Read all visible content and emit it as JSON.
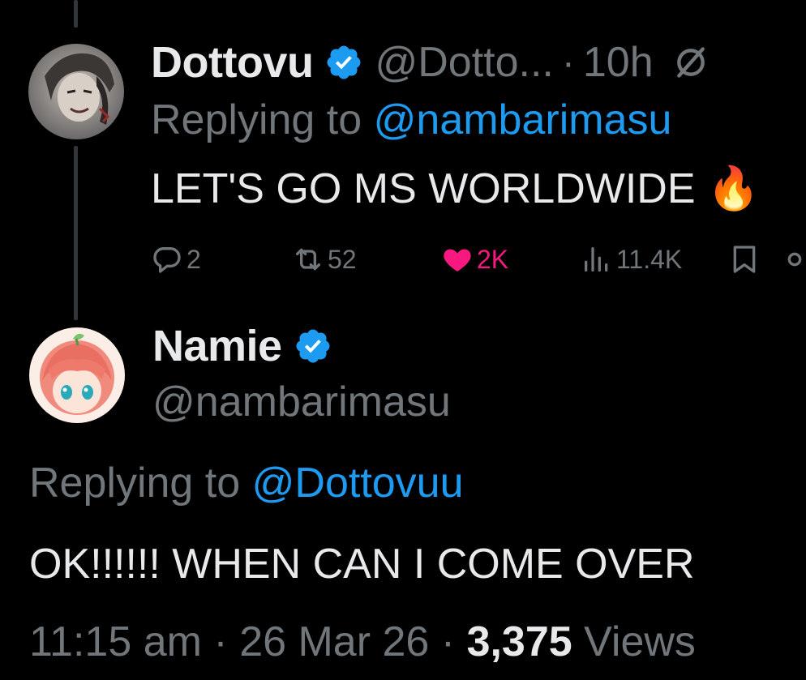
{
  "parent_tweet": {
    "display_name": "Dottovu",
    "handle": "@Dotto...",
    "separator": "·",
    "time_ago": "10h",
    "replying_prefix": "Replying to",
    "replying_to": "@nambarimasu",
    "text": "LET'S GO MS WORLDWIDE",
    "emoji": "🔥",
    "actions": {
      "replies": "2",
      "retweets": "52",
      "likes": "2K",
      "views": "11.4K"
    }
  },
  "main_tweet": {
    "display_name": "Namie",
    "handle": "@nambarimasu",
    "replying_prefix": "Replying to",
    "replying_to": "@Dottovuu",
    "text": "OK!!!!!! WHEN CAN I COME OVER",
    "time": "11:15 am",
    "separator": "·",
    "date": "26 Mar 26",
    "views_count": "3,375",
    "views_label": "Views"
  },
  "colors": {
    "background": "#000000",
    "text": "#e7e9ea",
    "muted": "#71767b",
    "link": "#1d9bf0",
    "verified": "#1d9bf0",
    "like": "#f91880",
    "thread_line": "#333639"
  },
  "icons": [
    "verified-badge-icon",
    "grok-icon",
    "reply-icon",
    "retweet-icon",
    "like-icon",
    "views-icon",
    "bookmark-icon",
    "share-icon"
  ]
}
